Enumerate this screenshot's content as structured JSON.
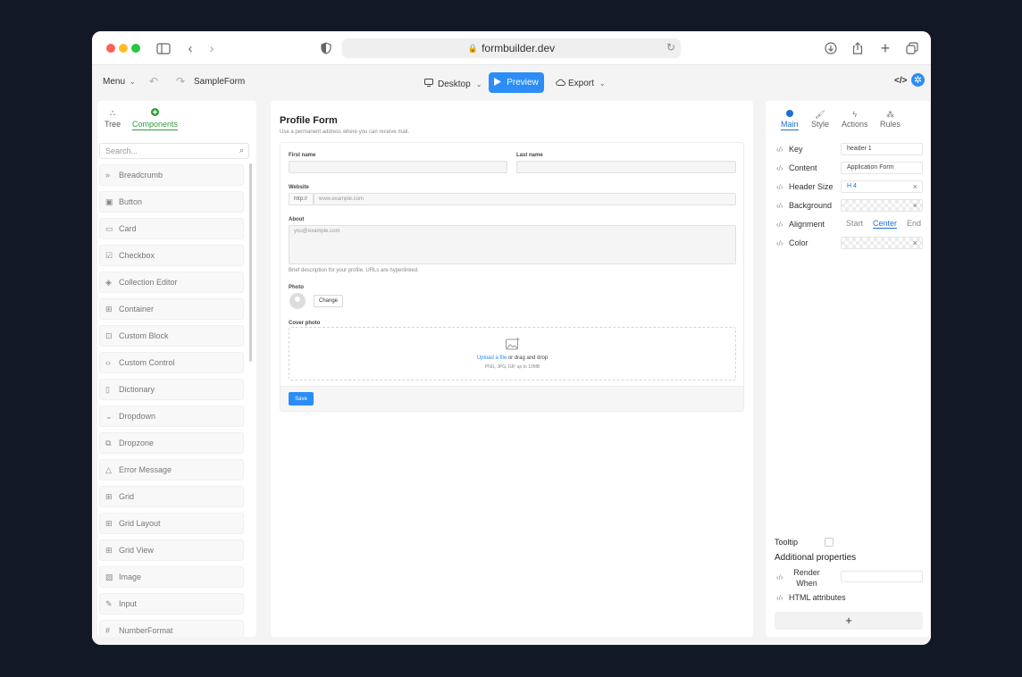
{
  "browser": {
    "url": "formbuilder.dev"
  },
  "toolbar": {
    "menu_label": "Menu",
    "form_name": "SampleForm",
    "device_label": "Desktop",
    "preview_label": "Preview",
    "export_label": "Export",
    "code_icon": "</>"
  },
  "left_panel": {
    "tabs": [
      {
        "label": "Tree",
        "icon": "tree-icon"
      },
      {
        "label": "Components",
        "icon": "plus-circle-icon"
      }
    ],
    "search_placeholder": "Search...",
    "components": [
      {
        "label": "Breadcrumb",
        "icon": "breadcrumb-icon"
      },
      {
        "label": "Button",
        "icon": "button-icon"
      },
      {
        "label": "Card",
        "icon": "card-icon"
      },
      {
        "label": "Checkbox",
        "icon": "checkbox-icon"
      },
      {
        "label": "Collection Editor",
        "icon": "layers-icon"
      },
      {
        "label": "Container",
        "icon": "container-icon"
      },
      {
        "label": "Custom Block",
        "icon": "grid-icon"
      },
      {
        "label": "Custom Control",
        "icon": "code-icon"
      },
      {
        "label": "Dictionary",
        "icon": "book-icon"
      },
      {
        "label": "Dropdown",
        "icon": "chevron-down-icon"
      },
      {
        "label": "Dropzone",
        "icon": "dropzone-icon"
      },
      {
        "label": "Error Message",
        "icon": "warning-icon"
      },
      {
        "label": "Grid",
        "icon": "grid-icon"
      },
      {
        "label": "Grid Layout",
        "icon": "grid-icon"
      },
      {
        "label": "Grid View",
        "icon": "grid-icon"
      },
      {
        "label": "Image",
        "icon": "image-icon"
      },
      {
        "label": "Input",
        "icon": "edit-icon"
      },
      {
        "label": "NumberFormat",
        "icon": "number-icon"
      }
    ]
  },
  "form": {
    "title": "Profile Form",
    "subtitle": "Use a permanent address where you can receive mail.",
    "first_name_label": "First name",
    "last_name_label": "Last name",
    "website_label": "Website",
    "website_prefix": "http://",
    "website_placeholder": "www.example.com",
    "about_label": "About",
    "about_placeholder": "you@example.com",
    "about_note": "Brief description for your profile. URLs are hyperlinked.",
    "photo_label": "Photo",
    "change_label": "Change",
    "cover_label": "Cover photo",
    "upload_link": "Upload a file",
    "upload_rest": "or drag and drop",
    "upload_hint": "PNG, JPG, GIF up to 10MB",
    "save_label": "Save"
  },
  "right_panel": {
    "tabs": [
      {
        "label": "Main",
        "icon": "dot-icon"
      },
      {
        "label": "Style",
        "icon": "brush-icon"
      },
      {
        "label": "Actions",
        "icon": "bolt-icon"
      },
      {
        "label": "Rules",
        "icon": "rules-icon"
      }
    ],
    "props": {
      "key_label": "Key",
      "key_value": "header 1",
      "content_label": "Content",
      "content_value": "Application Form",
      "header_size_label": "Header Size",
      "header_size_value": "H 4",
      "background_label": "Background",
      "alignment_label": "Alignment",
      "align_start": "Start",
      "align_center": "Center",
      "align_end": "End",
      "color_label": "Color"
    },
    "tooltip_label": "Tooltip",
    "additional_label": "Additional properties",
    "render_when_label": "Render When",
    "html_attributes_label": "HTML attributes",
    "add_label": "+"
  },
  "colors": {
    "accent": "#2b8df5",
    "components_tab": "#2e9c3c"
  }
}
